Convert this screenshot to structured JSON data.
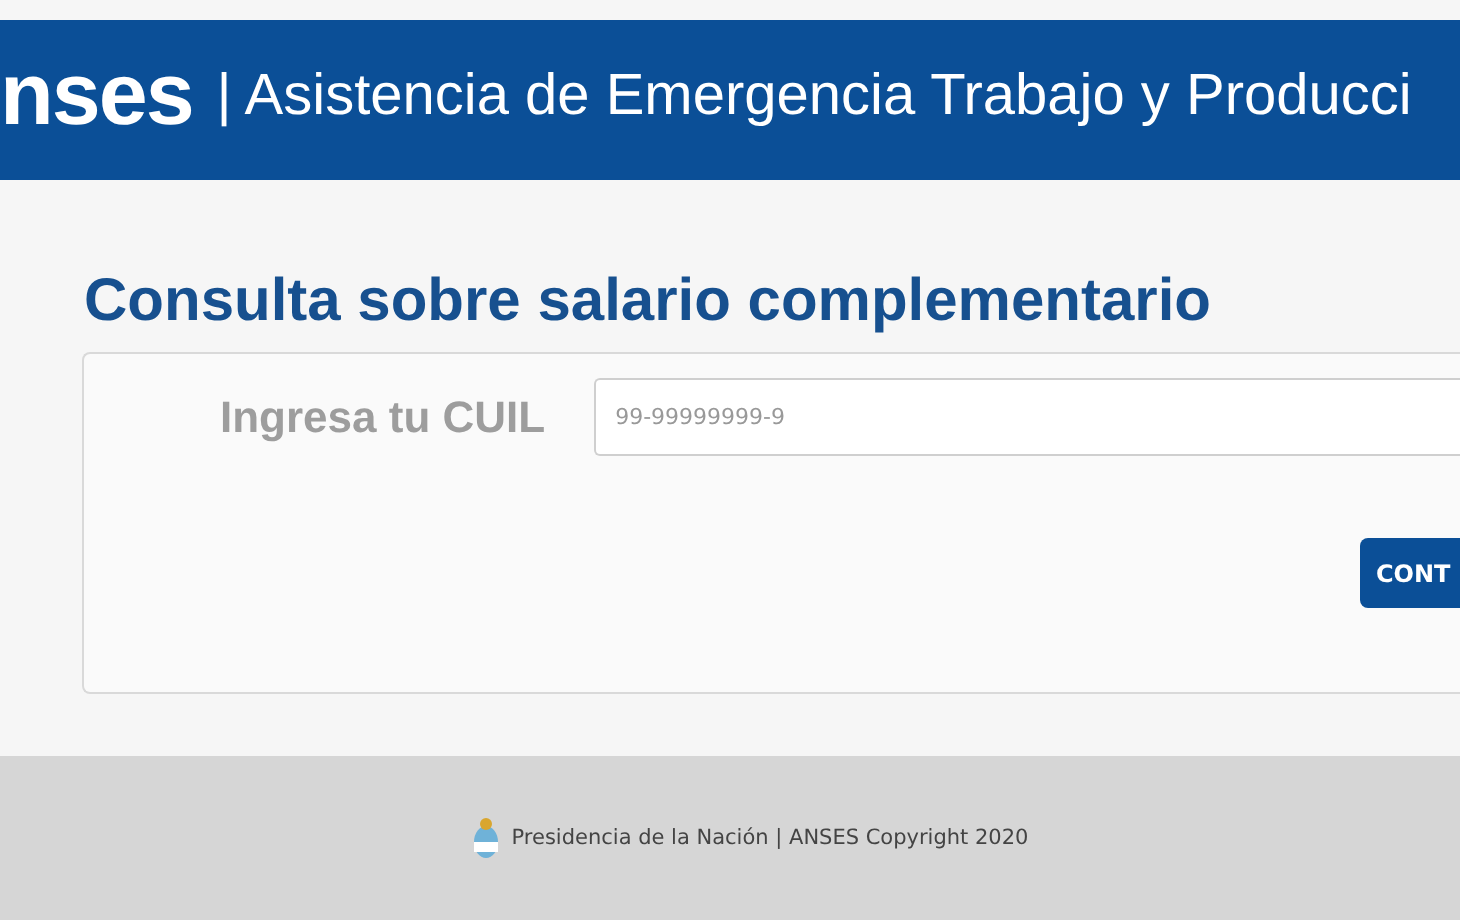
{
  "header": {
    "logo": "nses",
    "title": "| Asistencia de Emergencia Trabajo y Producci"
  },
  "page": {
    "heading": "Consulta sobre salario complementario"
  },
  "form": {
    "label": "Ingresa tu CUIL",
    "field": {
      "placeholder": "99-99999999-9"
    },
    "button": "CONT"
  },
  "footer": {
    "text": "Presidencia de la Nación | ANSES Copyright 2020"
  }
}
